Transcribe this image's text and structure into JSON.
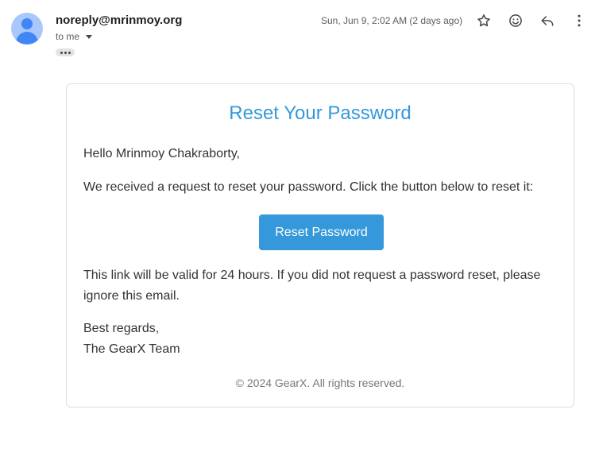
{
  "header": {
    "sender": "noreply@mrinmoy.org",
    "to_label": "to me",
    "timestamp": "Sun, Jun 9, 2:02 AM (2 days ago)"
  },
  "icons": {
    "avatar": "avatar-icon",
    "star": "star-icon",
    "emoji": "emoji-icon",
    "reply": "reply-icon",
    "more": "more-vert-icon",
    "expand": "ellipsis-icon"
  },
  "email": {
    "title": "Reset Your Password",
    "greeting": "Hello Mrinmoy Chakraborty,",
    "intro": "We received a request to reset your password. Click the button below to reset it:",
    "button_label": "Reset Password",
    "validity_line1": "This link will be valid for 24 hours. If you did not request a password reset, please",
    "validity_line2": "ignore this email.",
    "signoff": "Best regards,",
    "team": "The GearX Team",
    "footer": "© 2024 GearX. All rights reserved."
  },
  "colors": {
    "accent": "#3498db",
    "avatar_bg": "#a8c7fa",
    "avatar_fg": "#4285f4"
  }
}
